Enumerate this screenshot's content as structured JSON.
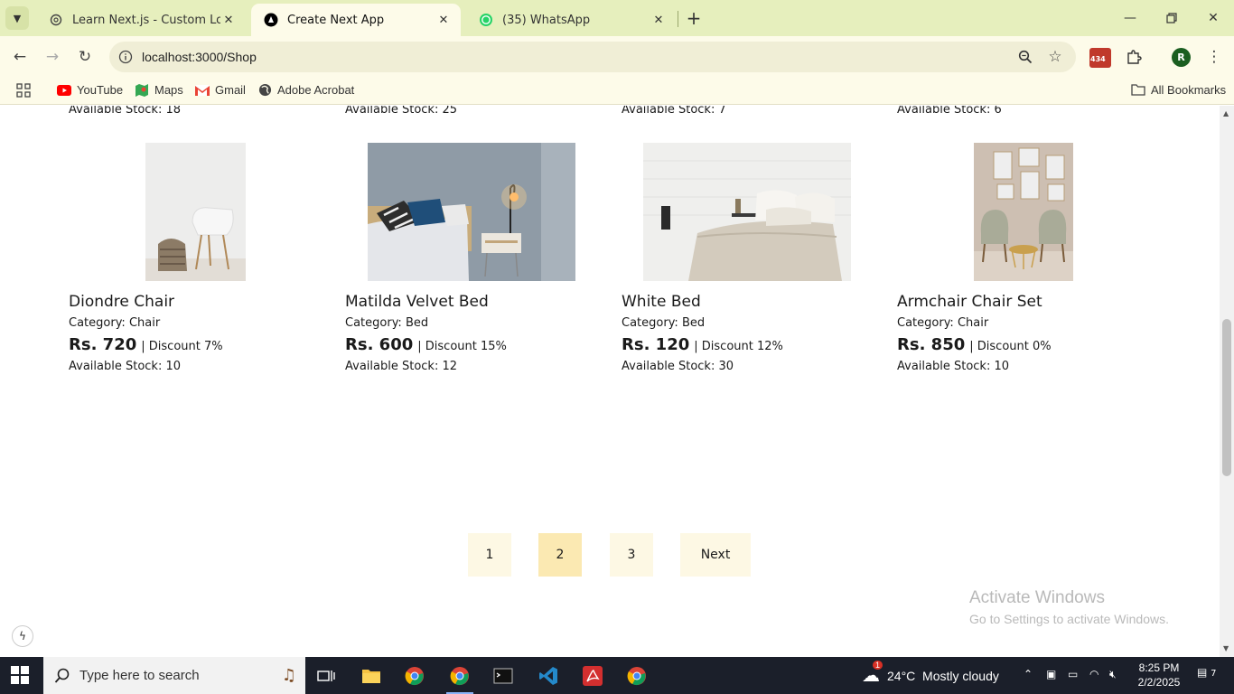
{
  "browser": {
    "tabs": [
      {
        "title": "Learn Next.js - Custom Localhost",
        "active": false
      },
      {
        "title": "Create Next App",
        "active": true
      },
      {
        "title": "(35) WhatsApp",
        "active": false
      }
    ],
    "url": "localhost:3000/Shop",
    "extension_badge": "434",
    "profile_initial": "R",
    "bookmarks": [
      "YouTube",
      "Maps",
      "Gmail",
      "Adobe Acrobat"
    ],
    "all_bookmarks": "All Bookmarks"
  },
  "shop": {
    "previous_row_stock": [
      "Available Stock: 18",
      "Available Stock: 25",
      "Available Stock: 7",
      "Available Stock: 6"
    ],
    "products": [
      {
        "name": "Diondre Chair",
        "category": "Category: Chair",
        "price": "Rs. 720",
        "discount": "| Discount 7%",
        "stock": "Available Stock: 10"
      },
      {
        "name": "Matilda Velvet Bed",
        "category": "Category: Bed",
        "price": "Rs. 600",
        "discount": "| Discount 15%",
        "stock": "Available Stock: 12"
      },
      {
        "name": "White Bed",
        "category": "Category: Bed",
        "price": "Rs. 120",
        "discount": "| Discount 12%",
        "stock": "Available Stock: 30"
      },
      {
        "name": "Armchair Chair Set",
        "category": "Category: Chair",
        "price": "Rs. 850",
        "discount": "| Discount 0%",
        "stock": "Available Stock: 10"
      }
    ],
    "pagination": {
      "pages": [
        "1",
        "2",
        "3"
      ],
      "current": "2",
      "next": "Next"
    }
  },
  "watermark": {
    "line1": "Activate Windows",
    "line2": "Go to Settings to activate Windows."
  },
  "taskbar": {
    "search_placeholder": "Type here to search",
    "weather": "24°C  Mostly cloudy",
    "weather_badge": "1",
    "time": "8:25 PM",
    "date": "2/2/2025",
    "notifications": "7"
  },
  "colors": {
    "tabstrip": "#e6efbd",
    "toolbar": "#fdfbe9",
    "pager": "#fdf8e4",
    "pager_active": "#fbe9b2",
    "taskbar": "#1b1f2a"
  }
}
